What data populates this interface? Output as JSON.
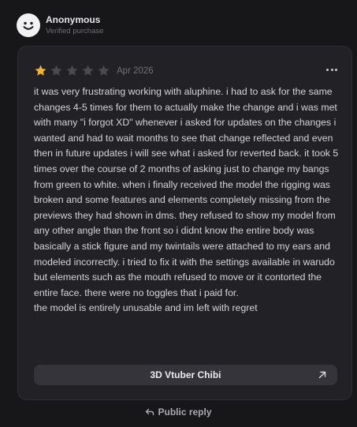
{
  "reviewer": {
    "name": "Anonymous",
    "badge": "Verified purchase",
    "avatar_icon": "smiley-face-icon"
  },
  "review": {
    "rating": 1,
    "max_rating": 5,
    "date": "Apr 2026",
    "paragraphs": [
      "it was very frustrating working with aluphine. i had to ask for the same changes 4-5 times for them to actually make the change and i was met with many \"i forgot XD\" whenever i asked for updates on the changes i wanted and had to wait months to see that change reflected and even then in future updates i will see what i asked for reverted back. it took 5 times over the course of 2 months of asking just to change my bangs from green to white. when i finally received the model the rigging was broken and some features and elements completely missing from the previews they had shown in dms. they refused to show my model from any other angle than the front so i didnt know the entire body was basically a stick figure and my twintails were attached to my ears and modeled incorrectly. i tried to fix it with the settings available in warudo but elements such as the mouth refused to move or it contorted the entire face. there were no toggles that i paid for.",
      "the model is entirely unusable and im left with regret"
    ],
    "product": "3D Vtuber Chibi"
  },
  "actions": {
    "public_reply": "Public reply",
    "more_icon": "more-options-icon"
  },
  "colors": {
    "star_filled": "#f3b52d",
    "star_empty": "#4a4a50",
    "background": "#17171a",
    "card": "#222226",
    "chip": "#34343a"
  }
}
